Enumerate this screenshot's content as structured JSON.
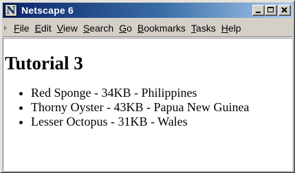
{
  "window": {
    "title": "Netscape 6",
    "app_icon_letter": "N"
  },
  "menu": {
    "items": [
      {
        "mnemonic": "F",
        "rest": "ile"
      },
      {
        "mnemonic": "E",
        "rest": "dit"
      },
      {
        "mnemonic": "V",
        "rest": "iew"
      },
      {
        "mnemonic": "S",
        "rest": "earch"
      },
      {
        "mnemonic": "G",
        "rest": "o"
      },
      {
        "mnemonic": "B",
        "rest": "ookmarks"
      },
      {
        "mnemonic": "T",
        "rest": "asks"
      },
      {
        "mnemonic": "H",
        "rest": "elp"
      }
    ]
  },
  "page": {
    "heading": "Tutorial 3",
    "list": [
      "Red Sponge - 34KB - Philippines",
      "Thorny Oyster - 43KB - Papua New Guinea",
      "Lesser Octopus - 31KB - Wales"
    ]
  },
  "colors": {
    "title_bar_start": "#0a246a",
    "title_bar_end": "#a6caf0",
    "chrome": "#d4d0c8",
    "content_bg": "#ffffff"
  }
}
